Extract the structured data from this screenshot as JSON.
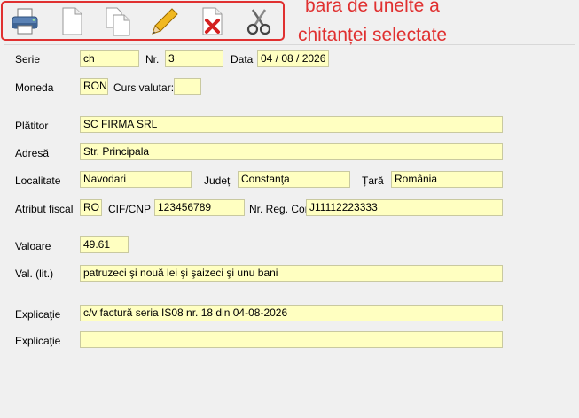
{
  "annotation": {
    "line1": "bara de unelte a",
    "line2": "chitanței selectate"
  },
  "toolbar": {
    "buttons": [
      {
        "icon": "printer-icon",
        "name": "print-button"
      },
      {
        "icon": "new-document-icon",
        "name": "new-button"
      },
      {
        "icon": "copy-document-icon",
        "name": "copy-button"
      },
      {
        "icon": "pencil-icon",
        "name": "edit-button"
      },
      {
        "icon": "delete-document-icon",
        "name": "delete-button"
      },
      {
        "icon": "scissors-icon",
        "name": "cut-button"
      }
    ]
  },
  "form": {
    "serie_label": "Serie",
    "serie": "ch",
    "nr_label": "Nr.",
    "nr": "3",
    "data_label": "Data",
    "data": "04 / 08 / 2026",
    "moneda_label": "Moneda",
    "moneda": "RON",
    "curs_label": "Curs valutar:",
    "curs": "",
    "platitor_label": "Plătitor",
    "platitor": "SC FIRMA SRL",
    "adresa_label": "Adresă",
    "adresa": "Str. Principala",
    "localitate_label": "Localitate",
    "localitate": "Navodari",
    "judet_label": "Județ",
    "judet": "Constanţa",
    "tara_label": "Țară",
    "tara": "România",
    "atribut_label": "Atribut fiscal",
    "atribut": "RO",
    "cif_label": "CIF/CNP",
    "cif": "123456789",
    "regcom_label": "Nr. Reg. Com.",
    "regcom": "J11112223333",
    "valoare_label": "Valoare",
    "valoare": "49.61",
    "vallit_label": "Val. (lit.)",
    "vallit": "patruzeci şi nouă lei şi şaizeci şi unu bani",
    "explicatie1_label": "Explicaţie",
    "explicatie1": "c/v factură seria IS08 nr. 18 din 04-08-2026",
    "explicatie2_label": "Explicaţie",
    "explicatie2": ""
  }
}
